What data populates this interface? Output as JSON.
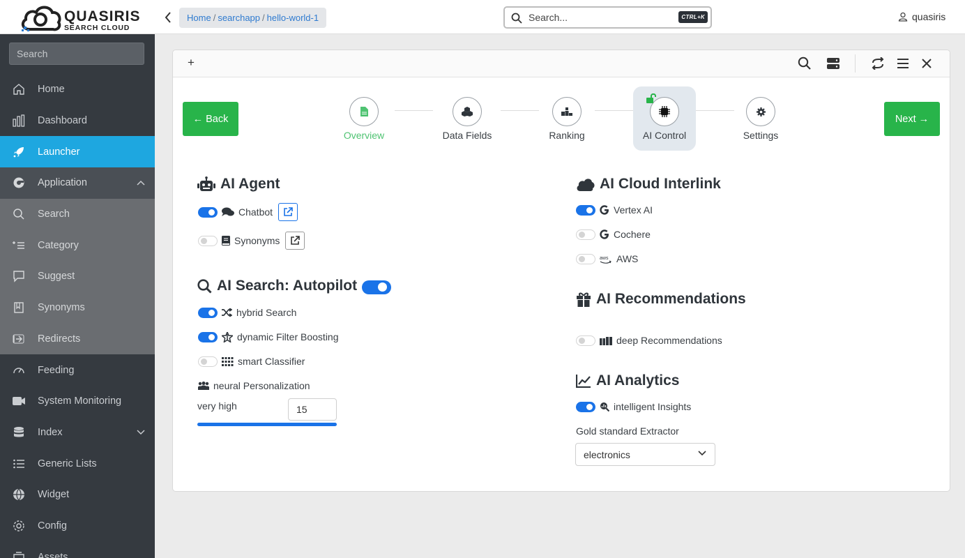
{
  "brand": {
    "name": "QUASIRIS",
    "tagline": "SEARCH CLOUD"
  },
  "breadcrumb": [
    "Home",
    "searchapp",
    "hello-world-1"
  ],
  "global_search": {
    "placeholder": "Search...",
    "shortcut": "CTRL+K"
  },
  "user": {
    "name": "quasiris"
  },
  "sidebar": {
    "search_placeholder": "Search",
    "items": [
      {
        "label": "Home",
        "icon": "home-icon"
      },
      {
        "label": "Dashboard",
        "icon": "bar-chart-icon"
      },
      {
        "label": "Launcher",
        "icon": "rocket-icon",
        "state": "active"
      },
      {
        "label": "Application",
        "icon": "application-icon",
        "state": "expanded"
      },
      {
        "label": "Search",
        "icon": "search-icon"
      },
      {
        "label": "Category",
        "icon": "category-icon"
      },
      {
        "label": "Suggest",
        "icon": "suggest-icon"
      },
      {
        "label": "Synonyms",
        "icon": "book-icon"
      },
      {
        "label": "Redirects",
        "icon": "redirect-icon"
      },
      {
        "label": "Feeding",
        "icon": "gauge-icon"
      },
      {
        "label": "System Monitoring",
        "icon": "camera-icon"
      },
      {
        "label": "Index",
        "icon": "database-icon",
        "state": "collapsed"
      },
      {
        "label": "Generic Lists",
        "icon": "list-icon"
      },
      {
        "label": "Widget",
        "icon": "globe-icon"
      },
      {
        "label": "Config",
        "icon": "gear-icon"
      },
      {
        "label": "Assets",
        "icon": "assets-icon"
      }
    ]
  },
  "panel": {
    "add_label": "+",
    "back_label": "← Back",
    "next_label": "Next →",
    "steps": [
      {
        "label": "Overview",
        "icon": "file-icon",
        "state": "done"
      },
      {
        "label": "Data Fields",
        "icon": "cubes-icon"
      },
      {
        "label": "Ranking",
        "icon": "podium-icon"
      },
      {
        "label": "AI Control",
        "icon": "chip-icon",
        "state": "current"
      },
      {
        "label": "Settings",
        "icon": "gear-icon"
      }
    ]
  },
  "ai_agent": {
    "title": "AI Agent",
    "chatbot": {
      "label": "Chatbot",
      "enabled": true
    },
    "synonyms": {
      "label": "Synonyms",
      "enabled": false
    }
  },
  "ai_search": {
    "title": "AI Search: Autopilot",
    "enabled": true,
    "hybrid": {
      "label": "hybrid Search",
      "enabled": true
    },
    "dynamic": {
      "label": "dynamic Filter Boosting",
      "enabled": true
    },
    "smart": {
      "label": "smart Classifier",
      "enabled": false
    },
    "neural": {
      "label": "neural Personalization"
    },
    "level_label": "very high",
    "level_value": "15",
    "level_fraction": 1.0
  },
  "ai_cloud": {
    "title": "AI Cloud Interlink",
    "vertex": {
      "label": "Vertex AI",
      "enabled": true
    },
    "cochere": {
      "label": "Cochere",
      "enabled": false
    },
    "aws": {
      "label": "AWS",
      "enabled": false
    }
  },
  "ai_reco": {
    "title": "AI Recommendations",
    "deep": {
      "label": "deep Recommendations",
      "enabled": false
    }
  },
  "ai_analytics": {
    "title": "AI Analytics",
    "insights": {
      "label": "intelligent Insights",
      "enabled": true
    },
    "extractor_label": "Gold standard Extractor",
    "extractor_value": "electronics"
  },
  "colors": {
    "accent": "#1ea7e0",
    "green": "#28b44a",
    "toggle_on": "#1a73e8",
    "sidebar": "#353a40"
  }
}
